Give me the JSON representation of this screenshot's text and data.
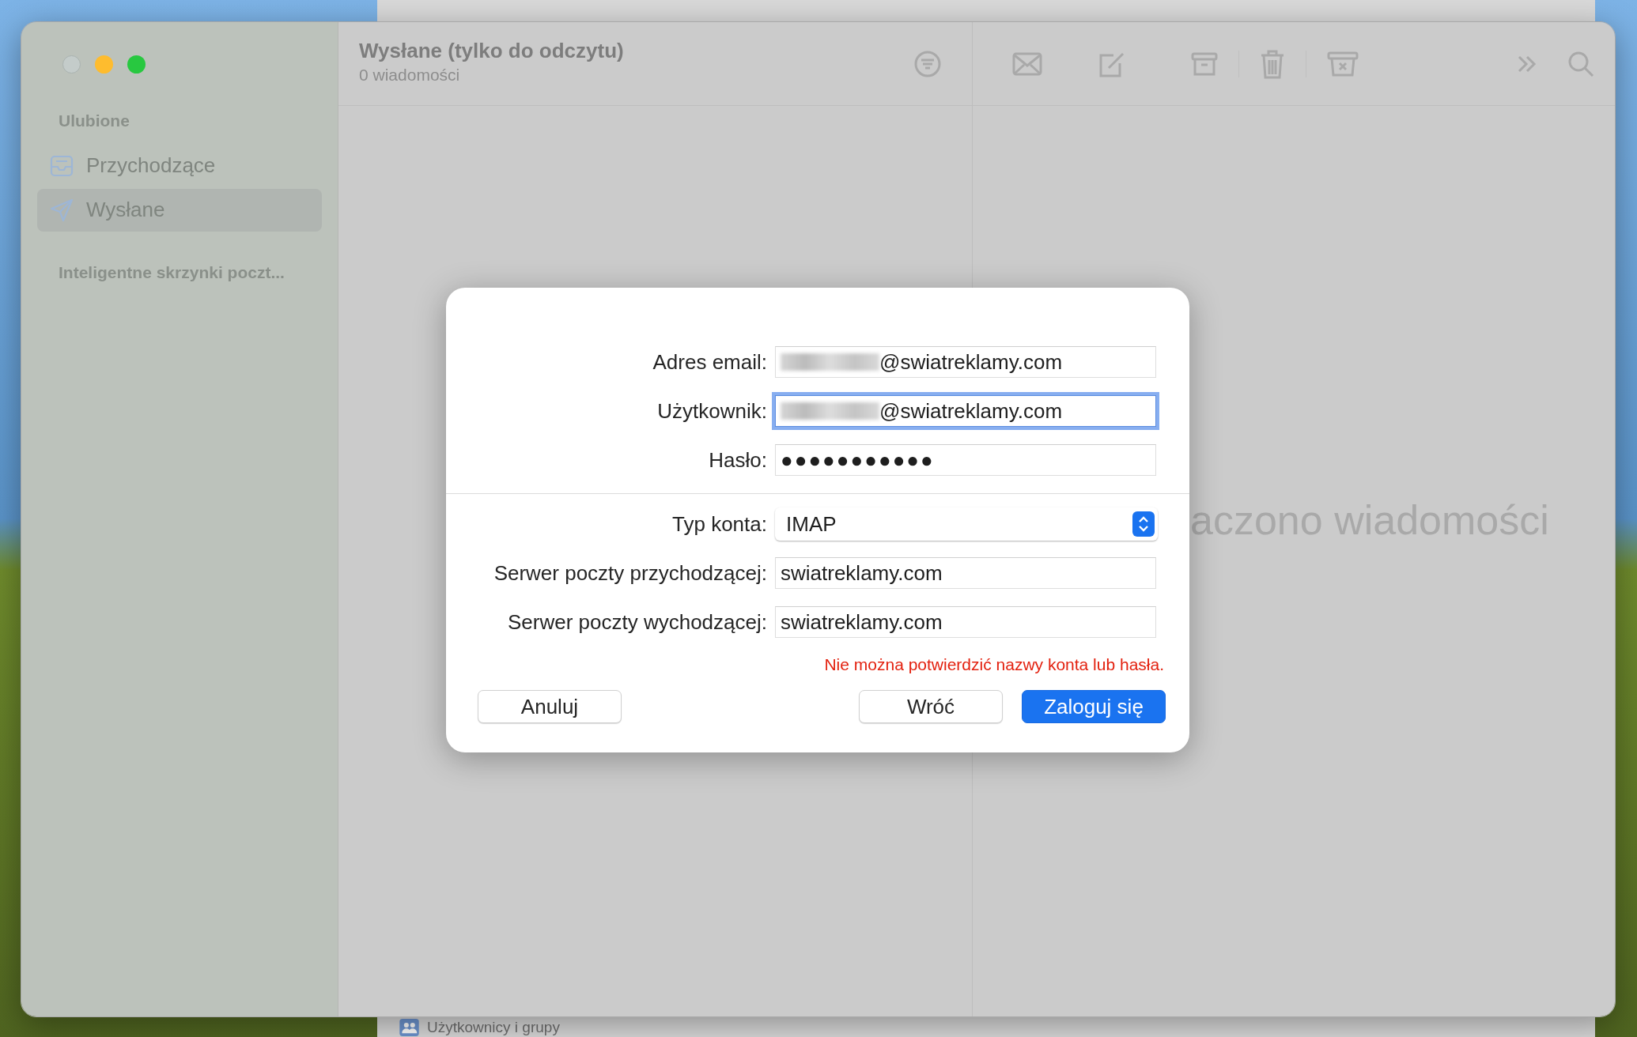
{
  "sidebar": {
    "sections": [
      {
        "title": "Ulubione",
        "items": [
          {
            "label": "Przychodzące",
            "kind": "inbox",
            "selected": false
          },
          {
            "label": "Wysłane",
            "kind": "sent",
            "selected": true
          }
        ]
      },
      {
        "title": "Inteligentne skrzynki poczt..."
      }
    ]
  },
  "message_list": {
    "title": "Wysłane (tylko do odczytu)",
    "subtitle": "0 wiadomości"
  },
  "viewer": {
    "text": "aczono wiadomości"
  },
  "background_window": {
    "item": "Użytkownicy i grupy"
  },
  "dialog": {
    "sections": [
      [
        {
          "label": "Adres email:",
          "value": "@swiatreklamy.com",
          "kind": "text",
          "redacted": true,
          "focused": false
        },
        {
          "label": "Użytkownik:",
          "value": "@swiatreklamy.com",
          "kind": "text",
          "redacted": true,
          "focused": true
        },
        {
          "label": "Hasło:",
          "value": "●●●●●●●●●●●",
          "kind": "password",
          "redacted": false,
          "focused": false
        }
      ],
      [
        {
          "label": "Typ konta:",
          "value": "IMAP",
          "kind": "select",
          "redacted": false,
          "focused": false
        },
        {
          "label": "Serwer poczty przychodzącej:",
          "value": "swiatreklamy.com",
          "kind": "text",
          "redacted": false,
          "focused": false
        },
        {
          "label": "Serwer poczty wychodzącej:",
          "value": "swiatreklamy.com",
          "kind": "text",
          "redacted": false,
          "focused": false
        }
      ]
    ],
    "error": "Nie można potwierdzić nazwy konta lub hasła.",
    "buttons": [
      {
        "label": "Anuluj",
        "kind": "default"
      },
      {
        "label": "Wróć",
        "kind": "default"
      },
      {
        "label": "Zaloguj się",
        "kind": "primary"
      }
    ]
  }
}
